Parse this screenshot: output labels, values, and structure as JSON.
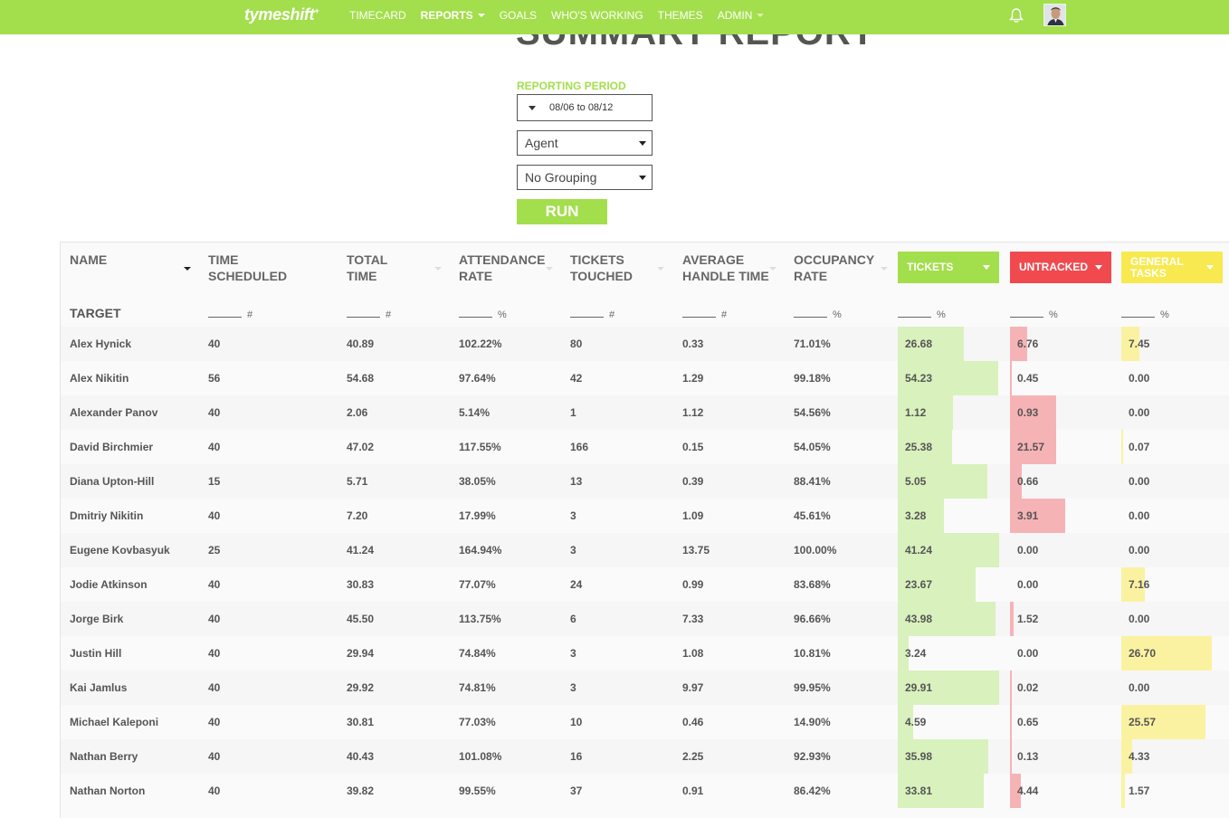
{
  "nav": {
    "logo": "tymeshift",
    "logo_mark": "+",
    "items": [
      {
        "label": "TIMECARD",
        "active": false,
        "dropdown": false
      },
      {
        "label": "REPORTS",
        "active": true,
        "dropdown": true
      },
      {
        "label": "GOALS",
        "active": false,
        "dropdown": false
      },
      {
        "label": "WHO'S WORKING",
        "active": false,
        "dropdown": false
      },
      {
        "label": "THEMES",
        "active": false,
        "dropdown": false
      },
      {
        "label": "ADMIN",
        "active": false,
        "dropdown": true
      }
    ],
    "icons": [
      "bell-icon",
      "avatar"
    ],
    "accent_color": "#a3de4c"
  },
  "page": {
    "title": "SUMMARY REPORT",
    "reporting_period_label": "REPORTING PERIOD",
    "date_range": "08/06 to 08/12",
    "group_by": "Agent",
    "grouping": "No Grouping",
    "run_label": "RUN"
  },
  "table": {
    "headers": [
      {
        "label": "NAME"
      },
      {
        "label": "TIME SCHEDULED"
      },
      {
        "label": "TOTAL TIME"
      },
      {
        "label": "ATTENDANCE RATE"
      },
      {
        "label": "TICKETS TOUCHED"
      },
      {
        "label": "AVERAGE HANDLE TIME"
      },
      {
        "label": "OCCUPANCY RATE"
      }
    ],
    "pills": [
      {
        "label": "TICKETS",
        "color": "#a3de4c"
      },
      {
        "label": "UNTRACKED",
        "color": "#f04a4f"
      },
      {
        "label": "GENERAL TASKS",
        "color": "#f7e94f"
      }
    ],
    "target_label": "TARGET",
    "target_units": [
      "#",
      "#",
      "%",
      "#",
      "#",
      "%",
      "%",
      "%",
      "%"
    ],
    "rows": [
      {
        "name": "Alex Hynick",
        "scheduled": "40",
        "total": "40.89",
        "attendance": "102.22%",
        "touched": "80",
        "aht": "0.33",
        "occupancy": "71.01%",
        "tickets": "26.68",
        "untracked": "6.76",
        "general": "7.45"
      },
      {
        "name": "Alex Nikitin",
        "scheduled": "56",
        "total": "54.68",
        "attendance": "97.64%",
        "touched": "42",
        "aht": "1.29",
        "occupancy": "99.18%",
        "tickets": "54.23",
        "untracked": "0.45",
        "general": "0.00"
      },
      {
        "name": "Alexander Panov",
        "scheduled": "40",
        "total": "2.06",
        "attendance": "5.14%",
        "touched": "1",
        "aht": "1.12",
        "occupancy": "54.56%",
        "tickets": "1.12",
        "untracked": "0.93",
        "general": "0.00"
      },
      {
        "name": "David Birchmier",
        "scheduled": "40",
        "total": "47.02",
        "attendance": "117.55%",
        "touched": "166",
        "aht": "0.15",
        "occupancy": "54.05%",
        "tickets": "25.38",
        "untracked": "21.57",
        "general": "0.07"
      },
      {
        "name": "Diana Upton-Hill",
        "scheduled": "15",
        "total": "5.71",
        "attendance": "38.05%",
        "touched": "13",
        "aht": "0.39",
        "occupancy": "88.41%",
        "tickets": "5.05",
        "untracked": "0.66",
        "general": "0.00"
      },
      {
        "name": "Dmitriy Nikitin",
        "scheduled": "40",
        "total": "7.20",
        "attendance": "17.99%",
        "touched": "3",
        "aht": "1.09",
        "occupancy": "45.61%",
        "tickets": "3.28",
        "untracked": "3.91",
        "general": "0.00"
      },
      {
        "name": "Eugene Kovbasyuk",
        "scheduled": "25",
        "total": "41.24",
        "attendance": "164.94%",
        "touched": "3",
        "aht": "13.75",
        "occupancy": "100.00%",
        "tickets": "41.24",
        "untracked": "0.00",
        "general": "0.00"
      },
      {
        "name": "Jodie Atkinson",
        "scheduled": "40",
        "total": "30.83",
        "attendance": "77.07%",
        "touched": "24",
        "aht": "0.99",
        "occupancy": "83.68%",
        "tickets": "23.67",
        "untracked": "0.00",
        "general": "7.16"
      },
      {
        "name": "Jorge Birk",
        "scheduled": "40",
        "total": "45.50",
        "attendance": "113.75%",
        "touched": "6",
        "aht": "7.33",
        "occupancy": "96.66%",
        "tickets": "43.98",
        "untracked": "1.52",
        "general": "0.00"
      },
      {
        "name": "Justin Hill",
        "scheduled": "40",
        "total": "29.94",
        "attendance": "74.84%",
        "touched": "3",
        "aht": "1.08",
        "occupancy": "10.81%",
        "tickets": "3.24",
        "untracked": "0.00",
        "general": "26.70"
      },
      {
        "name": "Kai Jamlus",
        "scheduled": "40",
        "total": "29.92",
        "attendance": "74.81%",
        "touched": "3",
        "aht": "9.97",
        "occupancy": "99.95%",
        "tickets": "29.91",
        "untracked": "0.02",
        "general": "0.00"
      },
      {
        "name": "Michael Kaleponi",
        "scheduled": "40",
        "total": "30.81",
        "attendance": "77.03%",
        "touched": "10",
        "aht": "0.46",
        "occupancy": "14.90%",
        "tickets": "4.59",
        "untracked": "0.65",
        "general": "25.57"
      },
      {
        "name": "Nathan Berry",
        "scheduled": "40",
        "total": "40.43",
        "attendance": "101.08%",
        "touched": "16",
        "aht": "2.25",
        "occupancy": "92.93%",
        "tickets": "35.98",
        "untracked": "0.13",
        "general": "4.33"
      },
      {
        "name": "Nathan Norton",
        "scheduled": "40",
        "total": "39.82",
        "attendance": "99.55%",
        "touched": "37",
        "aht": "0.91",
        "occupancy": "86.42%",
        "tickets": "33.81",
        "untracked": "4.44",
        "general": "1.57"
      }
    ]
  }
}
